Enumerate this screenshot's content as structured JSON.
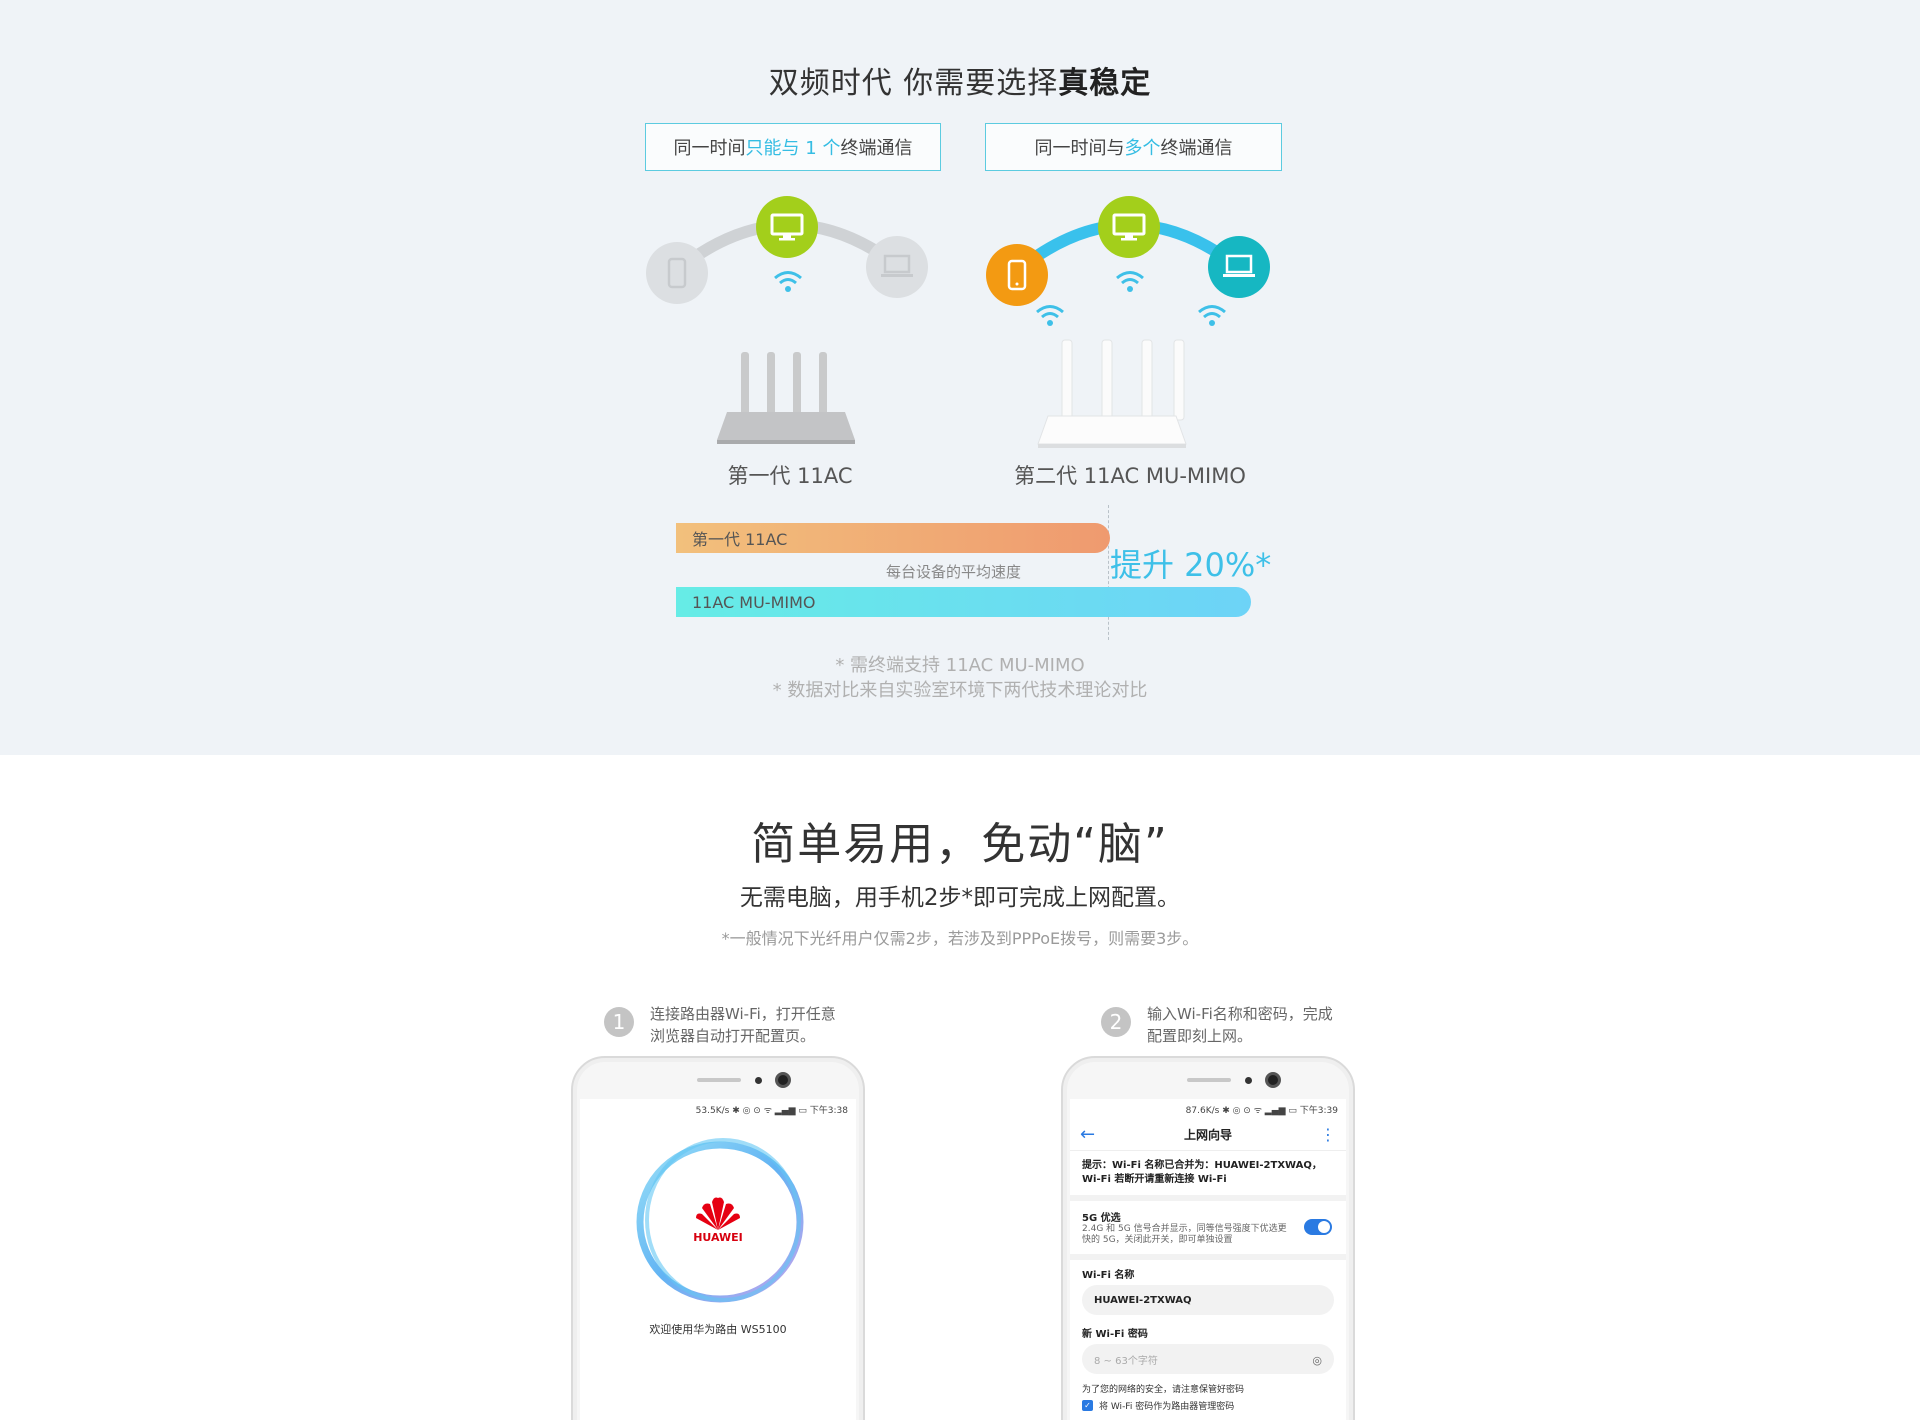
{
  "section1": {
    "title_light": "双频时代 你需要选择",
    "title_bold": "真稳定",
    "tag_left": {
      "prefix": "同一时间",
      "highlight": "只能与 1 个",
      "suffix": "终端通信"
    },
    "tag_right": {
      "prefix": "同一时间与",
      "highlight": "多个",
      "suffix": "终端通信"
    },
    "router_left_label": "第一代 11AC",
    "router_right_label": "第二代 11AC MU-MIMO",
    "icons": [
      "phone-icon",
      "monitor-icon",
      "laptop-icon",
      "wifi-icon",
      "router-icon"
    ],
    "colors": {
      "accent": "#35bde3",
      "lime": "#a3cf1b",
      "orange": "#f39a12",
      "teal": "#16b7c2",
      "gray": "#d8dbde"
    },
    "compare": {
      "bar1_label": "第一代 11AC",
      "bar1_value": 1.0,
      "bar2_label": "11AC MU-MIMO",
      "bar2_value": 1.2,
      "middle_label": "每台设备的平均速度",
      "boost": "提升 20%*"
    },
    "note1": "* 需终端支持 11AC MU-MIMO",
    "note2": "* 数据对比来自实验室环境下两代技术理论对比"
  },
  "section2": {
    "title": "简单易用，免动“脑”",
    "subtitle": "无需电脑，用手机2步*即可完成上网配置。",
    "note": "*一般情况下光纤用户仅需2步，若涉及到PPPoE拨号，则需要3步。",
    "step1": {
      "num": "1",
      "text": "连接路由器Wi-Fi，打开任意浏览器自动打开配置页。"
    },
    "step2": {
      "num": "2",
      "text": "输入Wi-Fi名称和密码，完成配置即刻上网。"
    },
    "phone1": {
      "status": "53.5K/s ✱ ◎ ⊙ ᯤ ▂▄▆ ▭ 下午3:38",
      "brand": "HUAWEI",
      "welcome": "欢迎使用华为路由 WS5100"
    },
    "phone2": {
      "status": "87.6K/s ✱ ◎ ⊙ ᯤ ▂▄▆ ▭ 下午3:39",
      "title": "上网向导",
      "hint": "提示：Wi-Fi 名称已合并为：HUAWEI-2TXWAQ，Wi-Fi 若断开请重新连接 Wi-Fi",
      "opt_title": "5G 优选",
      "opt_desc": "2.4G 和 5G 信号合并显示，同等信号强度下优选更快的 5G，关闭此开关，即可单独设置",
      "wifi_name_label": "Wi-Fi 名称",
      "wifi_name_value": "HUAWEI-2TXWAQ",
      "password_label": "新 Wi-Fi 密码",
      "password_placeholder": "8 ~ 63个字符",
      "security_note": "为了您的网络的安全，请注意保管好密码",
      "checkbox_label": "将 Wi-Fi 密码作为路由器管理密码"
    }
  }
}
